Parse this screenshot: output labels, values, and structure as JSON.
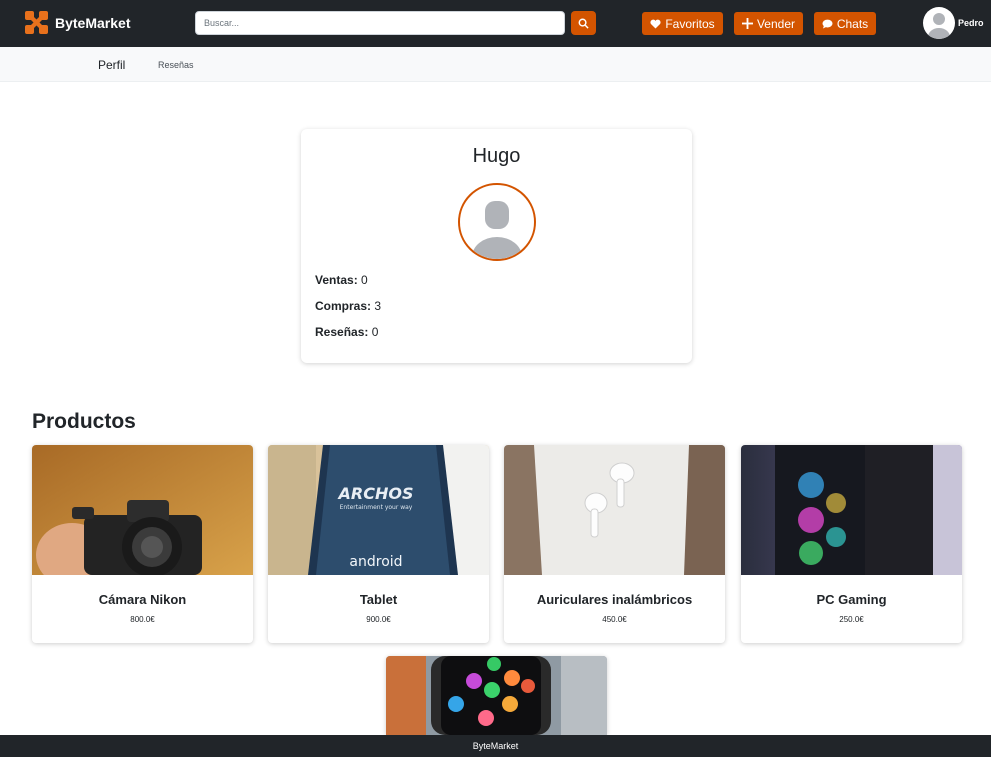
{
  "brand": {
    "name": "ByteMarket"
  },
  "search": {
    "placeholder": "Buscar..."
  },
  "nav": {
    "favorites": "Favoritos",
    "sell": "Vender",
    "chats": "Chats",
    "user": "Pedro"
  },
  "tabs": {
    "profile": "Perfil",
    "reviews": "Reseñas"
  },
  "profile": {
    "name": "Hugo",
    "sales_label": "Ventas:",
    "sales": "0",
    "purchases_label": "Compras:",
    "purchases": "3",
    "reviews_label": "Reseñas:",
    "reviews": "0"
  },
  "products_title": "Productos",
  "products": [
    {
      "title": "Cámara Nikon",
      "price": "800.0€"
    },
    {
      "title": "Tablet",
      "price": "900.0€"
    },
    {
      "title": "Auriculares inalámbricos",
      "price": "450.0€"
    },
    {
      "title": "PC Gaming",
      "price": "250.0€"
    }
  ],
  "footer": {
    "text": "ByteMarket"
  },
  "colors": {
    "accent": "#d35400",
    "navbar": "#212529"
  }
}
